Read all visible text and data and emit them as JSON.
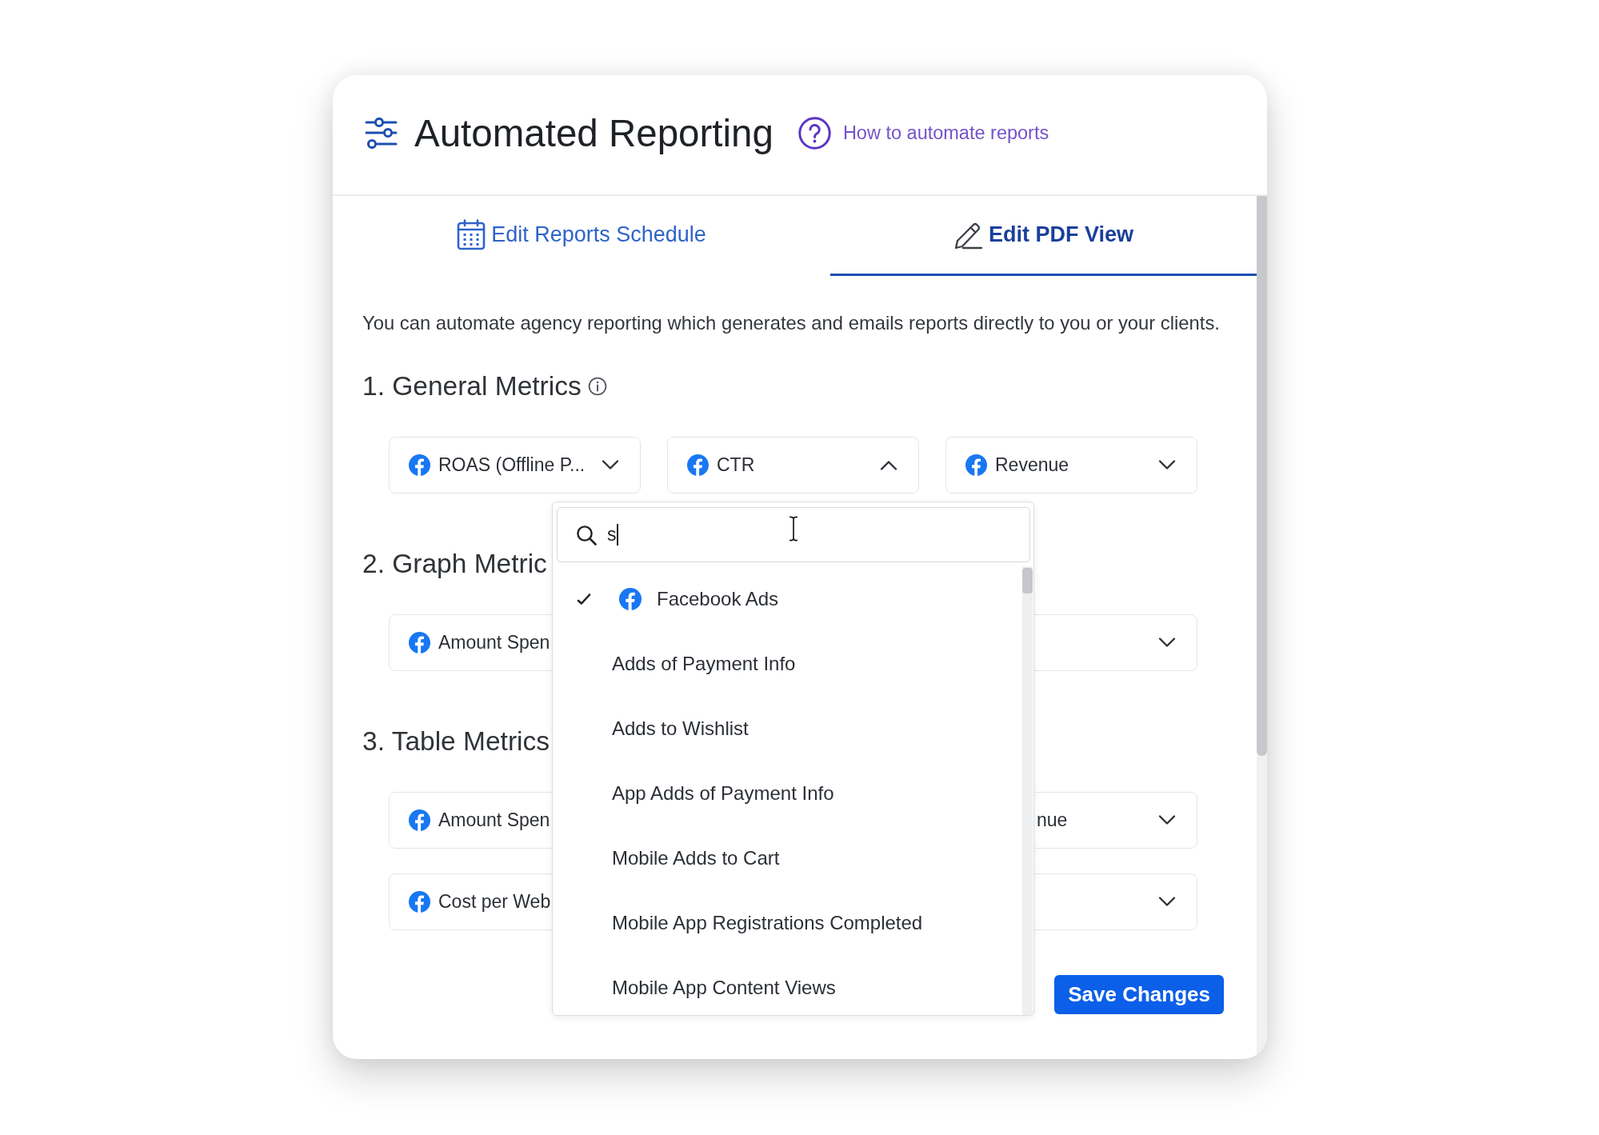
{
  "header": {
    "title": "Automated Reporting",
    "help_link": "How to automate reports"
  },
  "tabs": [
    {
      "label": "Edit Reports Schedule",
      "selected": false
    },
    {
      "label": "Edit PDF View",
      "selected": true
    }
  ],
  "description": "You can automate agency reporting which generates and emails reports directly to you or your clients.",
  "sections": [
    {
      "title": "1. General Metrics",
      "info": true,
      "rows": [
        {
          "dropdowns": [
            {
              "label": "ROAS (Offline P...",
              "expanded": false,
              "left_covered": false,
              "right_covered": false
            },
            {
              "label": "CTR",
              "expanded": true,
              "left_covered": false,
              "right_covered": false
            },
            {
              "label": "Revenue",
              "expanded": false,
              "left_covered": false,
              "right_covered": false
            }
          ]
        }
      ]
    },
    {
      "title": "2. Graph Metric",
      "info": false,
      "rows": [
        {
          "dropdowns": [
            {
              "label": "Amount Spen",
              "left_covered": false,
              "right_covered": true
            },
            {
              "expanded": false,
              "left_covered": true,
              "right_covered": false
            }
          ]
        }
      ]
    },
    {
      "title": "3. Table Metrics",
      "info": false,
      "rows": [
        {
          "dropdowns": [
            {
              "label": "Amount Spen",
              "left_covered": false,
              "right_covered": true
            },
            {
              "label": "nue",
              "expanded": false,
              "left_covered": true,
              "right_covered": false
            }
          ]
        },
        {
          "dropdowns": [
            {
              "label": "Cost per Web",
              "left_covered": false,
              "right_covered": true
            },
            {
              "expanded": false,
              "left_covered": true,
              "right_covered": false
            }
          ]
        }
      ]
    }
  ],
  "metric_menu": {
    "search": {
      "value": "s"
    },
    "items": [
      {
        "kind": "group",
        "label": "Facebook Ads",
        "checked": true
      },
      {
        "kind": "option",
        "label": "Adds of Payment Info",
        "selected": false
      },
      {
        "kind": "option",
        "label": "Adds to Wishlist",
        "selected": false
      },
      {
        "kind": "option",
        "label": "App Adds of Payment Info",
        "selected": false
      },
      {
        "kind": "option",
        "label": "Mobile Adds to Cart",
        "selected": false
      },
      {
        "kind": "option",
        "label": "Mobile App Registrations Completed",
        "selected": false
      },
      {
        "kind": "option",
        "label": "Mobile App Content Views",
        "selected": false
      }
    ]
  },
  "save_button": "Save Changes"
}
